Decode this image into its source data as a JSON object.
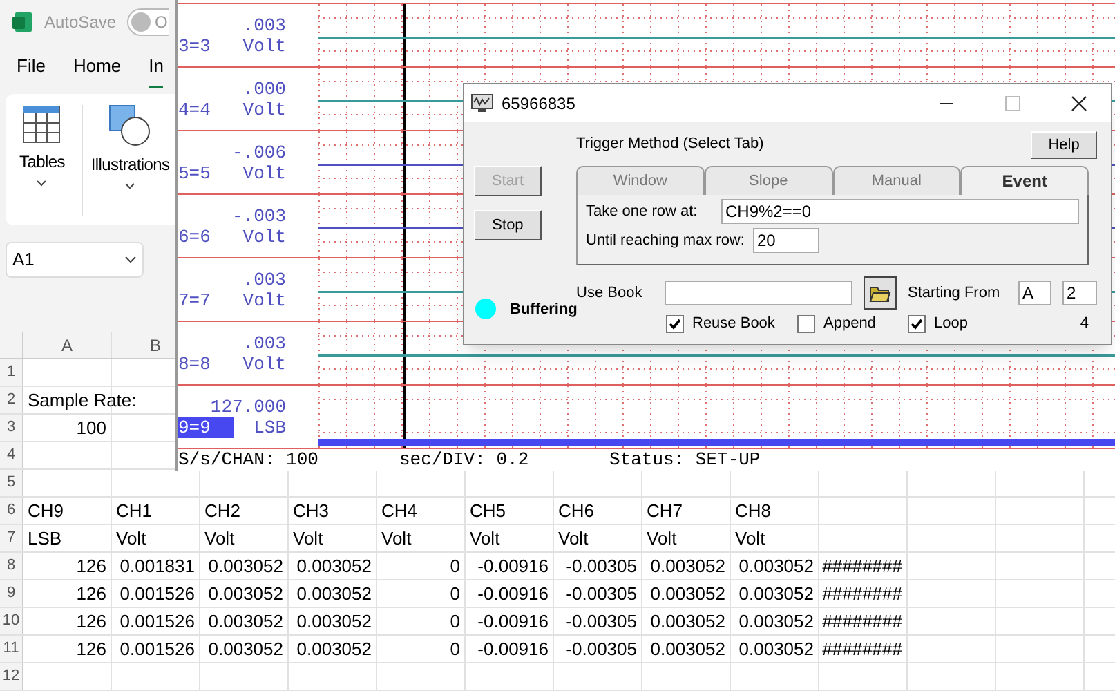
{
  "excel": {
    "title_bar": {
      "autosave_label": "AutoSave",
      "toggle_label": "O",
      "autosave_on": false
    },
    "tabs": [
      {
        "label": "File",
        "selected": false
      },
      {
        "label": "Home",
        "selected": false
      },
      {
        "label": "In",
        "selected": true
      }
    ],
    "ribbon_groups": [
      {
        "label": "Tables",
        "kind": "table"
      },
      {
        "label": "Illustrations",
        "kind": "shapes"
      }
    ],
    "name_box": "A1",
    "columns": [
      "A",
      "B"
    ],
    "rows": [
      {
        "number": "1"
      },
      {
        "number": "2",
        "kind": "text",
        "cells": [
          "Sample Rate:"
        ]
      },
      {
        "number": "3",
        "kind": "number",
        "cells": [
          "100"
        ]
      },
      {
        "number": "4"
      },
      {
        "number": "5"
      },
      {
        "number": "6",
        "kind": "text",
        "cells": [
          "CH9",
          "CH1",
          "CH2",
          "CH3",
          "CH4",
          "CH5",
          "CH6",
          "CH7",
          "CH8"
        ]
      },
      {
        "number": "7",
        "kind": "text",
        "cells": [
          "LSB",
          "Volt",
          "Volt",
          "Volt",
          "Volt",
          "Volt",
          "Volt",
          "Volt",
          "Volt"
        ]
      },
      {
        "number": "8",
        "kind": "number",
        "cells": [
          "126",
          "0.001831",
          "0.003052",
          "0.003052",
          "0",
          "-0.00916",
          "-0.00305",
          "0.003052",
          "0.003052",
          "########"
        ]
      },
      {
        "number": "9",
        "kind": "number",
        "cells": [
          "126",
          "0.001526",
          "0.003052",
          "0.003052",
          "0",
          "-0.00916",
          "-0.00305",
          "0.003052",
          "0.003052",
          "########"
        ]
      },
      {
        "number": "10",
        "kind": "number",
        "cells": [
          "126",
          "0.001526",
          "0.003052",
          "0.003052",
          "0",
          "-0.00916",
          "-0.00305",
          "0.003052",
          "0.003052",
          "########"
        ]
      },
      {
        "number": "11",
        "kind": "number",
        "cells": [
          "126",
          "0.001526",
          "0.003052",
          "0.003052",
          "0",
          "-0.00916",
          "-0.00305",
          "0.003052",
          "0.003052",
          "########"
        ]
      },
      {
        "number": "12"
      }
    ]
  },
  "chart_window": {
    "channels": [
      {
        "name": "3=3",
        "value": ".003",
        "unit": "Volt",
        "selected": false,
        "color": "#3a9a9a"
      },
      {
        "name": "4=4",
        "value": ".000",
        "unit": "Volt",
        "selected": false,
        "color": "#3a9a9a"
      },
      {
        "name": "5=5",
        "value": "-.006",
        "unit": "Volt",
        "selected": false,
        "color": "#5050c0"
      },
      {
        "name": "6=6",
        "value": "-.003",
        "unit": "Volt",
        "selected": false,
        "color": "#5050c0"
      },
      {
        "name": "7=7",
        "value": ".003",
        "unit": "Volt",
        "selected": false,
        "color": "#3a9a9a"
      },
      {
        "name": "8=8",
        "value": ".003",
        "unit": "Volt",
        "selected": false,
        "color": "#3a9a9a"
      },
      {
        "name": "9=9",
        "value": "127.000",
        "unit": "LSB",
        "selected": true,
        "color": "#4848f0"
      }
    ],
    "status_bar": [
      "S/s/CHAN: 100",
      "sec/DIV: 0.2",
      "Status: SET-UP"
    ]
  },
  "dialog": {
    "title": "65966835",
    "heading": "Trigger Method (Select Tab)",
    "help_button": "Help",
    "start_button": {
      "label": "Start",
      "disabled": true
    },
    "stop_button": {
      "label": "Stop",
      "disabled": false
    },
    "tabs": [
      {
        "label": "Window",
        "selected": false
      },
      {
        "label": "Slope",
        "selected": false
      },
      {
        "label": "Manual",
        "selected": false
      },
      {
        "label": "Event",
        "selected": true
      }
    ],
    "take_row_label": "Take one row at:",
    "take_row_value": "CH9%2==0",
    "max_row_label": "Until reaching max row:",
    "max_row_value": "20",
    "use_book_label": "Use Book",
    "starting_from_label": "Starting From",
    "start_column": "A",
    "start_row": "2",
    "status": {
      "label": "Buffering",
      "color": "#00ffff"
    },
    "checkboxes": [
      {
        "label": "Reuse Book",
        "checked": true
      },
      {
        "label": "Append",
        "checked": false
      },
      {
        "label": "Loop",
        "checked": true
      }
    ],
    "count": "4"
  }
}
